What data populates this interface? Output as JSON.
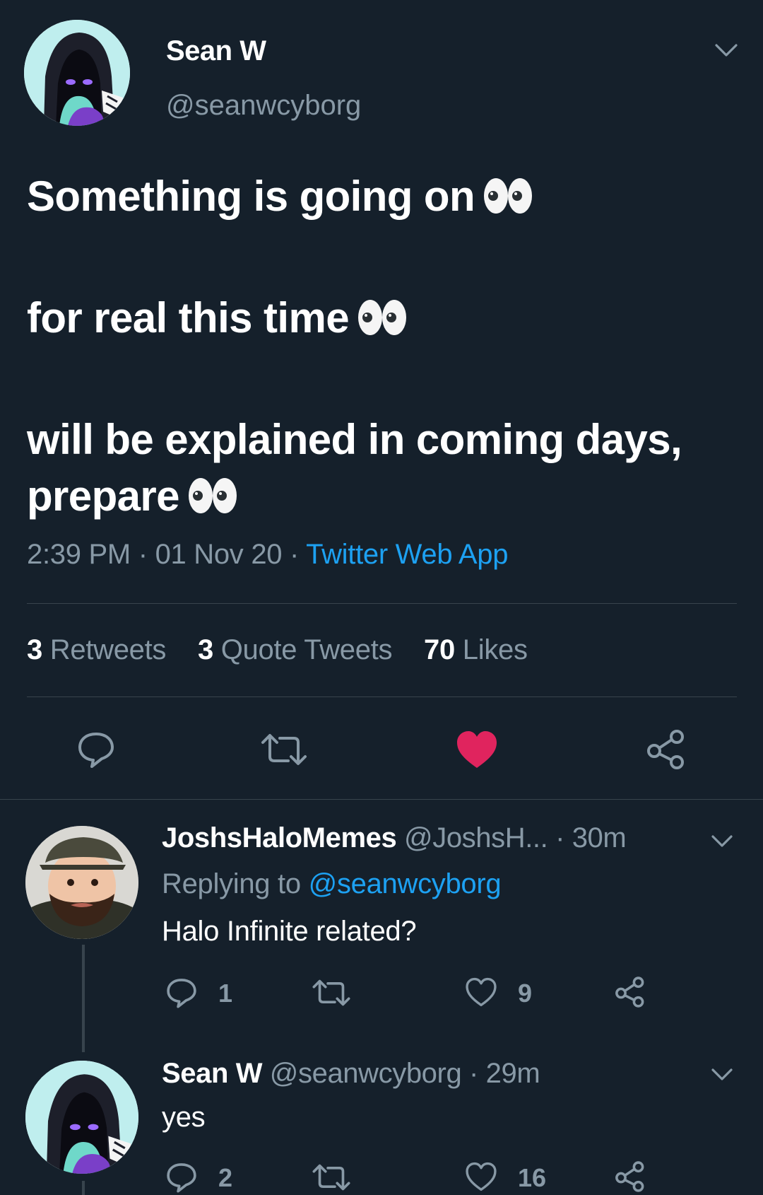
{
  "tweet": {
    "author_name": "Sean W",
    "author_handle": "@seanwcyborg",
    "text_lines": [
      "Something is going on",
      "for real this time",
      "will be explained in coming days,",
      "prepare"
    ],
    "time": "2:39 PM",
    "date": "01 Nov 20",
    "separator": "·",
    "source": "Twitter Web App",
    "stats": {
      "retweets_count": "3",
      "retweets_label": "Retweets",
      "quotes_count": "3",
      "quotes_label": "Quote Tweets",
      "likes_count": "70",
      "likes_label": "Likes"
    },
    "liked": true,
    "colors": {
      "like_active": "#e0245e",
      "link": "#1da1f2",
      "muted": "#8899a6",
      "background": "#15202b"
    }
  },
  "replies": [
    {
      "author_name": "JoshsHaloMemes",
      "author_handle": "@JoshsH...",
      "age": "· 30m",
      "replying_label": "Replying to",
      "replying_handle": "@seanwcyborg",
      "text": "Halo Infinite related?",
      "reply_count": "1",
      "like_count": "9"
    },
    {
      "author_name": "Sean W",
      "author_handle": "@seanwcyborg",
      "age": "· 29m",
      "text": "yes",
      "reply_count": "2",
      "like_count": "16"
    }
  ],
  "icons": {
    "reply": "speech-bubble-icon",
    "retweet": "retweet-icon",
    "like": "heart-icon",
    "share": "share-icon",
    "more": "chevron-down-icon",
    "emoji": "eyes-emoji"
  }
}
